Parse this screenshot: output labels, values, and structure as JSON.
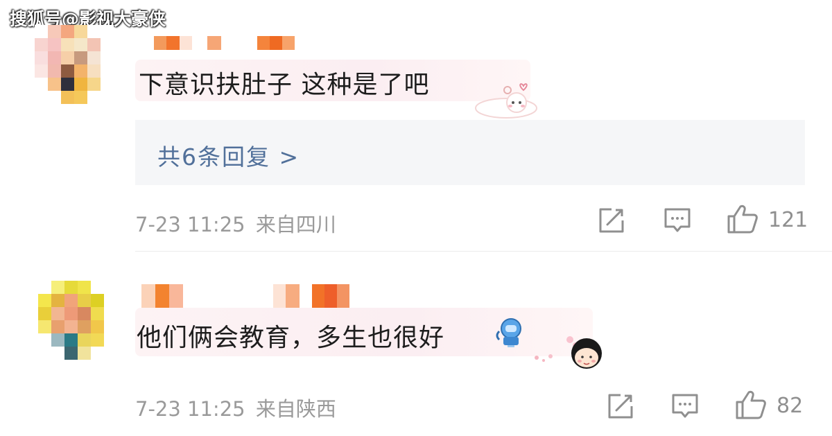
{
  "watermark": "搜狐号@影视大豪侠",
  "comments": [
    {
      "text": "下意识扶肚子 这种是了吧",
      "replies_label": "共6条回复 >",
      "timestamp": "7-23 11:25",
      "location": "来自四川",
      "likes": "121",
      "sticker": "cat-sticker"
    },
    {
      "text": "他们俩会教育，多生也很好",
      "timestamp": "7-23 11:25",
      "location": "来自陕西",
      "likes": "82",
      "sticker": "girl-sticker"
    }
  ],
  "icons": {
    "repost": "share-edit-icon",
    "comment": "comment-icon",
    "like": "thumbs-up-icon"
  },
  "colors": {
    "link": "#51709a",
    "meta": "#9a9a9a",
    "replies_bg": "#f5f6f8"
  }
}
